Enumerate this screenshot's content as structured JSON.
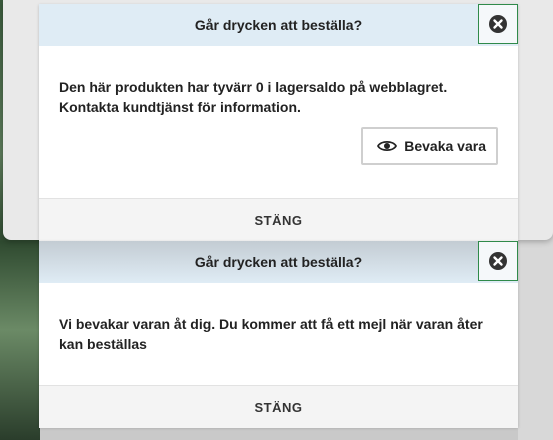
{
  "dialogs": [
    {
      "title": "Går drycken att beställa?",
      "message": "Den här produkten har tyvärr 0 i lagersaldo på webblagret. Kontakta kundtjänst för information.",
      "watch_button_label": "Bevaka vara",
      "close_label": "STÄNG"
    },
    {
      "title": "Går drycken att beställa?",
      "message": "Vi bevakar varan åt dig. Du kommer att få ett mejl när varan åter kan beställas",
      "close_label": "STÄNG"
    }
  ],
  "icons": {
    "close": "close-circle-icon",
    "watch": "eye-icon"
  },
  "colors": {
    "header_bg": "#dfecf5",
    "close_border": "#2f8a4a",
    "footer_bg": "#f4f4f4"
  }
}
